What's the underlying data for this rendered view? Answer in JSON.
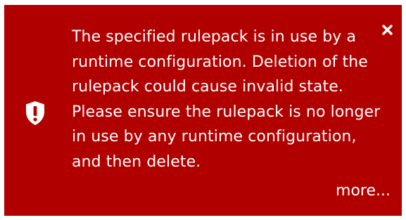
{
  "notification": {
    "message": "The specified rulepack is in use by a runtime configuration. Deletion of the rulepack could cause invalid state. Please ensure the rulepack is no longer in use by any runtime configuration, and then delete.",
    "more_label": "more...",
    "icon": "shield-exclamation-icon",
    "close_icon": "close-icon",
    "background_color": "#b00000",
    "text_color": "#ffffff"
  }
}
